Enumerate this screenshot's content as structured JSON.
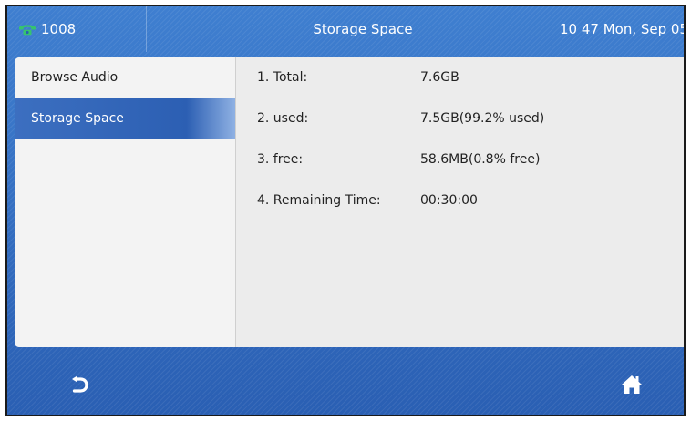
{
  "status_bar": {
    "line_number": "1008",
    "title": "Storage Space",
    "datetime": "10 47 Mon, Sep 05"
  },
  "menu": {
    "items": [
      {
        "label": "Browse Audio",
        "active": false
      },
      {
        "label": "Storage Space",
        "active": true
      }
    ]
  },
  "details": {
    "rows": [
      {
        "label": "1. Total:",
        "value": "7.6GB"
      },
      {
        "label": "2. used:",
        "value": "7.5GB(99.2% used)"
      },
      {
        "label": "3. free:",
        "value": "58.6MB(0.8% free)"
      },
      {
        "label": "4. Remaining Time:",
        "value": "00:30:00"
      }
    ]
  },
  "icons": {
    "line": "phone-icon",
    "back": "back-arrow-icon",
    "home": "home-icon"
  },
  "colors": {
    "header_blue": "#3f7fd0",
    "selected_blue": "#2c5fb3",
    "phone_green": "#36c46e"
  }
}
